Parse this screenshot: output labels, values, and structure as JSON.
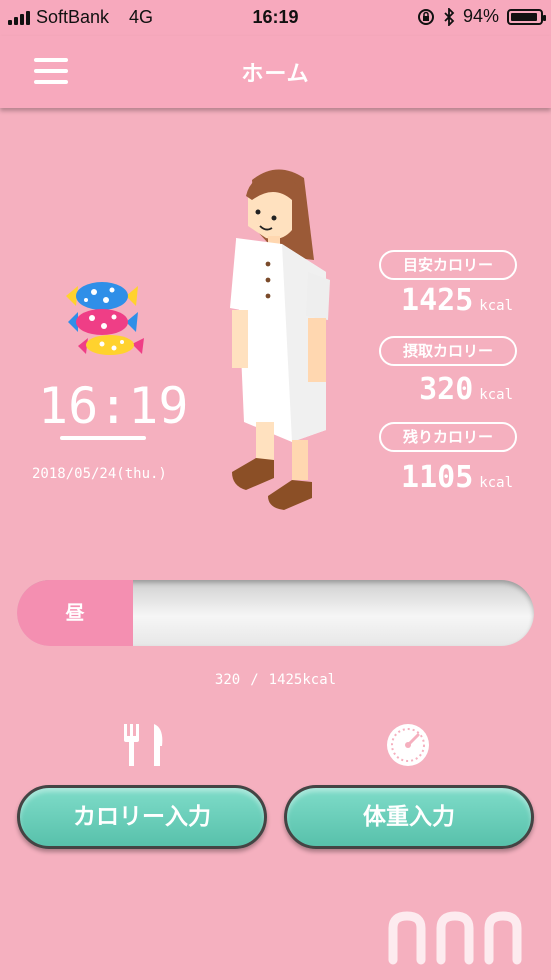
{
  "status_bar": {
    "carrier": "SoftBank",
    "network": "4G",
    "time": "16:19",
    "battery": "94%",
    "battery_level": 0.94,
    "icons": [
      "signal-icon",
      "orientation-lock-icon",
      "bluetooth-icon",
      "battery-icon"
    ]
  },
  "header": {
    "title": "ホーム",
    "menu_icon": "hamburger-menu-icon"
  },
  "clock": {
    "time": "16:19",
    "date": "2018/05/24(thu.)"
  },
  "calories": {
    "target": {
      "label": "目安カロリー",
      "value": "1425",
      "unit": "kcal"
    },
    "intake": {
      "label": "摂取カロリー",
      "value": "320",
      "unit": "kcal"
    },
    "remaining": {
      "label": "残りカロリー",
      "value": "1105",
      "unit": "kcal"
    }
  },
  "meal_bar": {
    "label": "昼",
    "current": "320",
    "separator": "/",
    "goal": "1425kcal"
  },
  "actions": {
    "calorie_input": "カロリー入力",
    "weight_input": "体重入力",
    "calorie_icon": "fork-knife-icon",
    "weight_icon": "scale-icon"
  },
  "colors": {
    "background": "#f5b0bf",
    "accent_pink": "#f48fb1",
    "button_green": "#58c1ab"
  }
}
